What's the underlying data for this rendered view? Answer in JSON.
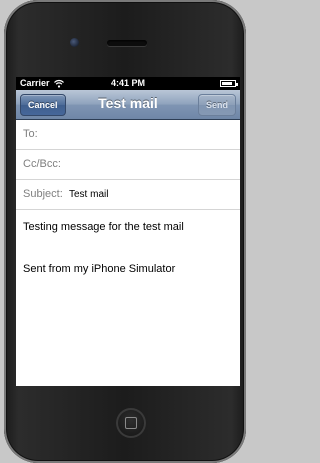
{
  "status_bar": {
    "carrier": "Carrier",
    "time": "4:41 PM",
    "battery_level": 0.85
  },
  "nav_bar": {
    "cancel_label": "Cancel",
    "title": "Test mail",
    "send_label": "Send"
  },
  "fields": {
    "to_label": "To:",
    "cc_label": "Cc/Bcc:",
    "subject_label": "Subject:",
    "subject_value": "Test mail"
  },
  "body": {
    "message": "Testing message for the test mail",
    "signature": "Sent from my iPhone Simulator"
  },
  "icons": [
    "wifi-icon",
    "battery-icon",
    "camera-icon",
    "speaker-icon",
    "home-button-icon"
  ]
}
